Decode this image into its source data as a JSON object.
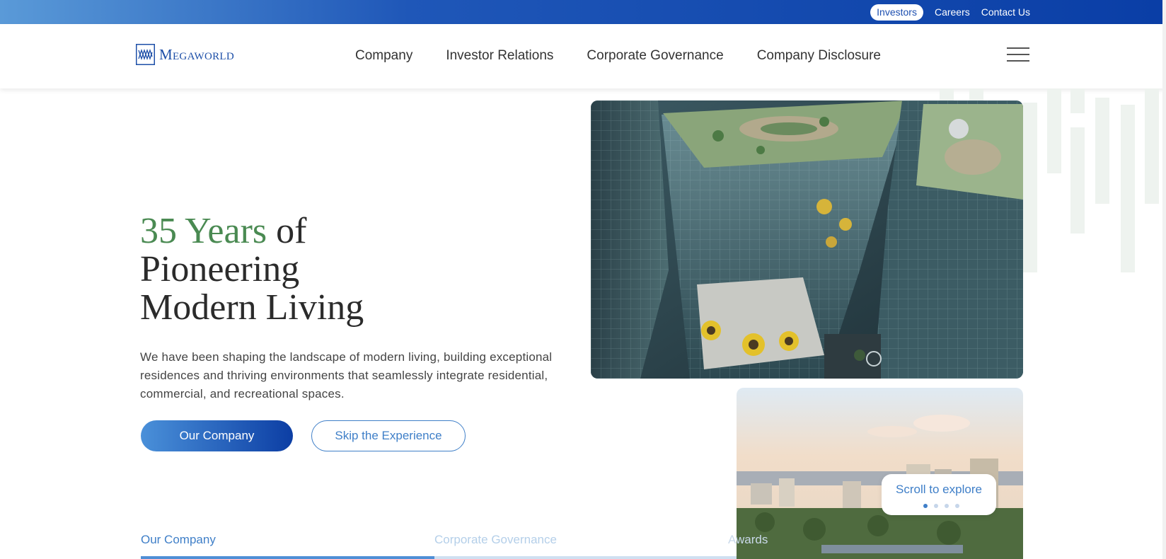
{
  "topbar": {
    "links": [
      "Investors",
      "Careers",
      "Contact Us"
    ]
  },
  "header": {
    "logo_text": "Megaworld",
    "nav": [
      "Company",
      "Investor Relations",
      "Corporate Governance",
      "Company Disclosure"
    ]
  },
  "hero": {
    "title_accent": "35 Years",
    "title_rest": " of",
    "title_line2": "Pioneering",
    "title_line3": "Modern Living",
    "description": "We have been shaping the landscape of modern living, building exceptional residences and thriving environments that seamlessly integrate residential, commercial, and recreational spaces.",
    "primary_button": "Our Company",
    "secondary_button": "Skip the Experience"
  },
  "scroll": {
    "label": "Scroll to explore",
    "dots_total": 4,
    "active_dot": 1
  },
  "tabs": [
    "Our Company",
    "Corporate Governance",
    "Awards"
  ],
  "colors": {
    "brand_blue": "#0a3ea6",
    "accent_green": "#4a8a52",
    "link_blue": "#3f7fc8"
  }
}
